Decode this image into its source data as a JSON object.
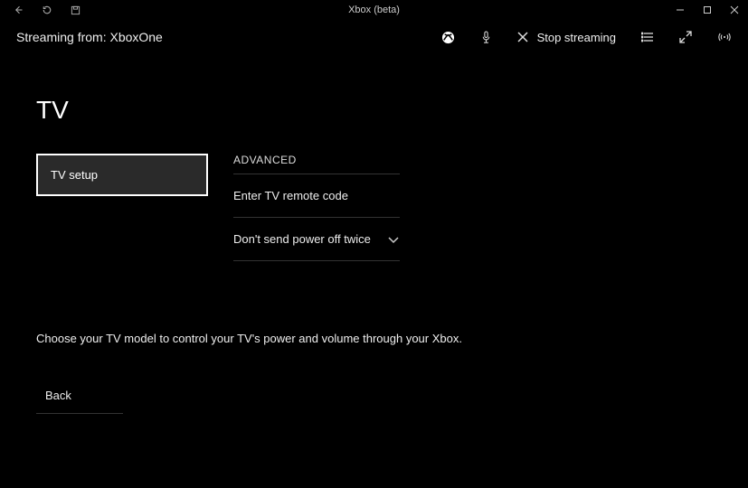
{
  "window": {
    "title": "Xbox (beta)"
  },
  "toolbar": {
    "streaming_label": "Streaming from: XboxOne",
    "stop_label": "Stop streaming"
  },
  "page": {
    "title": "TV",
    "selected_item": "TV setup",
    "section_heading": "ADVANCED",
    "rows": [
      {
        "label": "Enter TV remote code"
      },
      {
        "label": "Don't send power off twice"
      }
    ],
    "help_text": "Choose your TV model to control your TV's power and volume through your Xbox.",
    "back_label": "Back"
  }
}
